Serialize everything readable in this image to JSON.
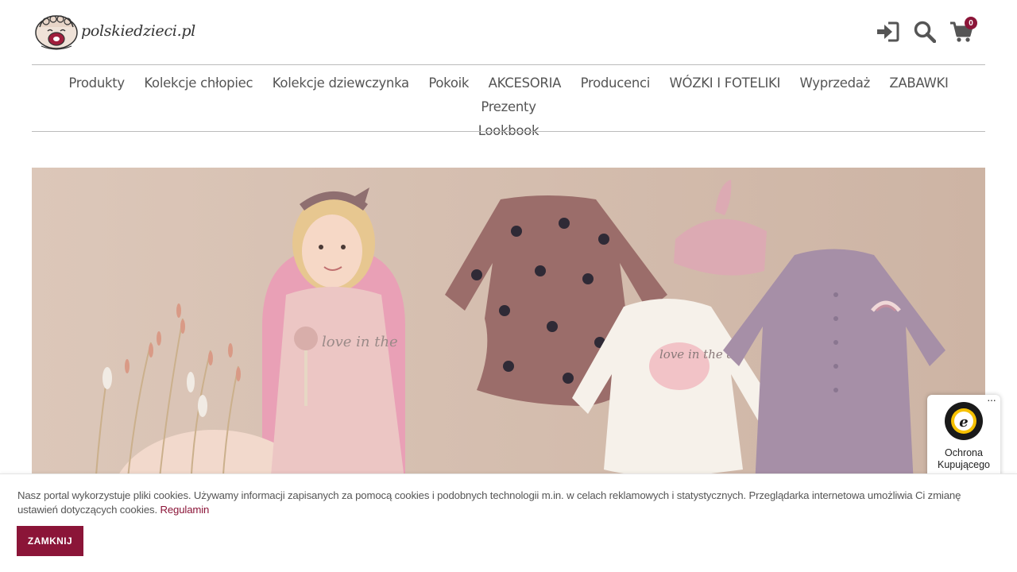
{
  "header": {
    "logo_text": "polskiedzieci.pl",
    "cart_count": "0",
    "icons": [
      "login-icon",
      "search-icon",
      "cart-icon"
    ]
  },
  "nav": {
    "items": [
      "Produkty",
      "Kolekcje chłopiec",
      "Kolekcje dziewczynka",
      "Pokoik",
      "AKCESORIA",
      "Producenci",
      "WÓZKI I FOTELIKI",
      "Wyprzedaż",
      "ZABAWKI",
      "Prezenty",
      "Lookbook"
    ]
  },
  "hero": {
    "onesie_text": "love in the air",
    "tshirt_text": "love in the"
  },
  "trusted_badge": {
    "label": "Ochrona Kupującego",
    "dots": "···"
  },
  "cookie": {
    "text": "Nasz portal wykorzystuje pliki cookies. Używamy informacji zapisanych za pomocą cookies i podobnych technologii m.in. w celach reklamowych i statystycznych. Przeglądarka internetowa umożliwia Ci zmianę ustawień dotyczących cookies.",
    "link_label": "Regulamin",
    "button_label": "ZAMKNIJ"
  },
  "colors": {
    "accent": "#8b1538",
    "hero_bg": "#d6c2b3",
    "text": "#555555"
  }
}
